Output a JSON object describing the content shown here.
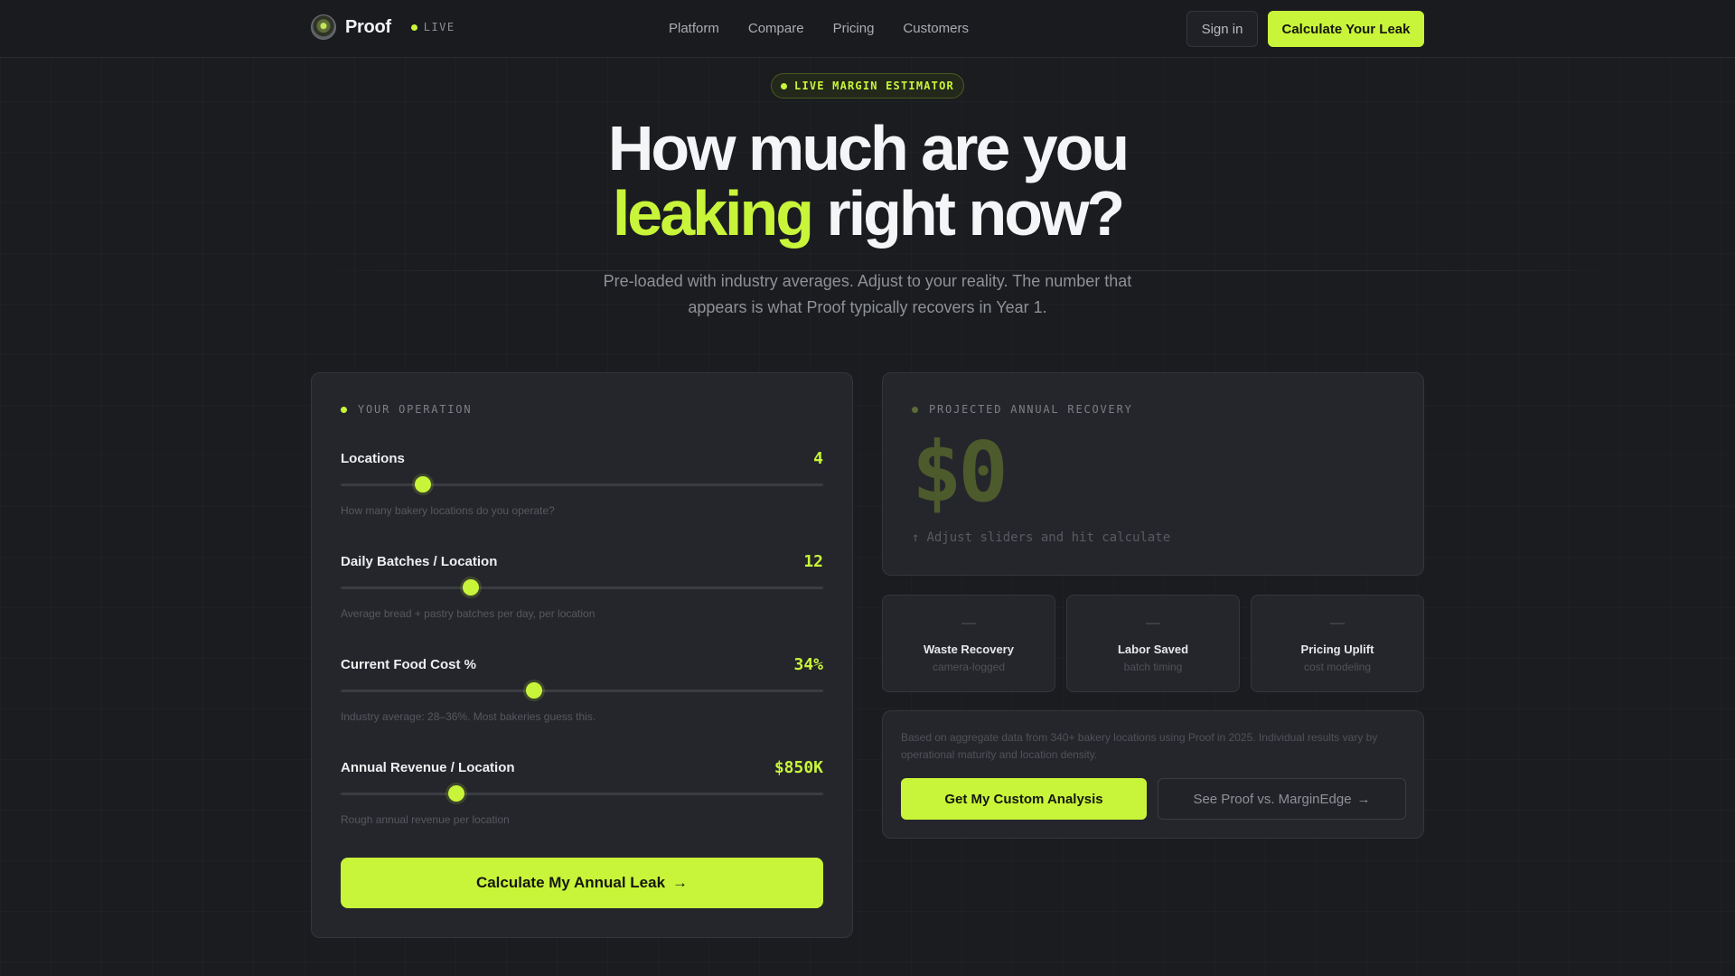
{
  "nav": {
    "brand": "Proof",
    "live_label": "LIVE",
    "links": [
      "Platform",
      "Compare",
      "Pricing",
      "Customers"
    ],
    "sign_in": "Sign in",
    "cta": "Calculate Your Leak"
  },
  "hero": {
    "badge": "LIVE MARGIN ESTIMATOR",
    "title_line1": "How much are you",
    "title_accent": "leaking",
    "title_line2_rest": " right now?",
    "subtitle": "Pre-loaded with industry averages. Adjust to your reality. The number that appears is what Proof typically recovers in Year 1."
  },
  "operation": {
    "section_label": "YOUR OPERATION",
    "fields": [
      {
        "label": "Locations",
        "value": "4",
        "hint": "How many bakery locations do you operate?",
        "level": 0.17
      },
      {
        "label": "Daily Batches / Location",
        "value": "12",
        "hint": "Average bread + pastry batches per day, per location",
        "level": 0.27
      },
      {
        "label": "Current Food Cost %",
        "value": "34%",
        "hint": "Industry average: 28–36%. Most bakeries guess this.",
        "level": 0.4
      },
      {
        "label": "Annual Revenue / Location",
        "value": "$850K",
        "hint": "Rough annual revenue per location",
        "level": 0.24
      }
    ],
    "submit": "Calculate My Annual Leak",
    "submit_arrow": "→"
  },
  "result": {
    "section_label": "PROJECTED ANNUAL RECOVERY",
    "value": "$0",
    "hint_arrow": "↑",
    "hint": "Adjust sliders and hit calculate"
  },
  "stats": [
    {
      "dash": "—",
      "title": "Waste Recovery",
      "sub": "camera-logged"
    },
    {
      "dash": "—",
      "title": "Labor Saved",
      "sub": "batch timing"
    },
    {
      "dash": "—",
      "title": "Pricing Uplift",
      "sub": "cost modeling"
    }
  ],
  "note": {
    "text": "Based on aggregate data from 340+ bakery locations using Proof in 2025. Individual results vary by operational maturity and location density.",
    "primary": "Get My Custom Analysis",
    "secondary": "See Proof vs. MarginEdge",
    "secondary_arrow": "→"
  },
  "colors": {
    "accent": "#c8f53a",
    "background": "#1b1c20",
    "panel": "#25262b"
  }
}
